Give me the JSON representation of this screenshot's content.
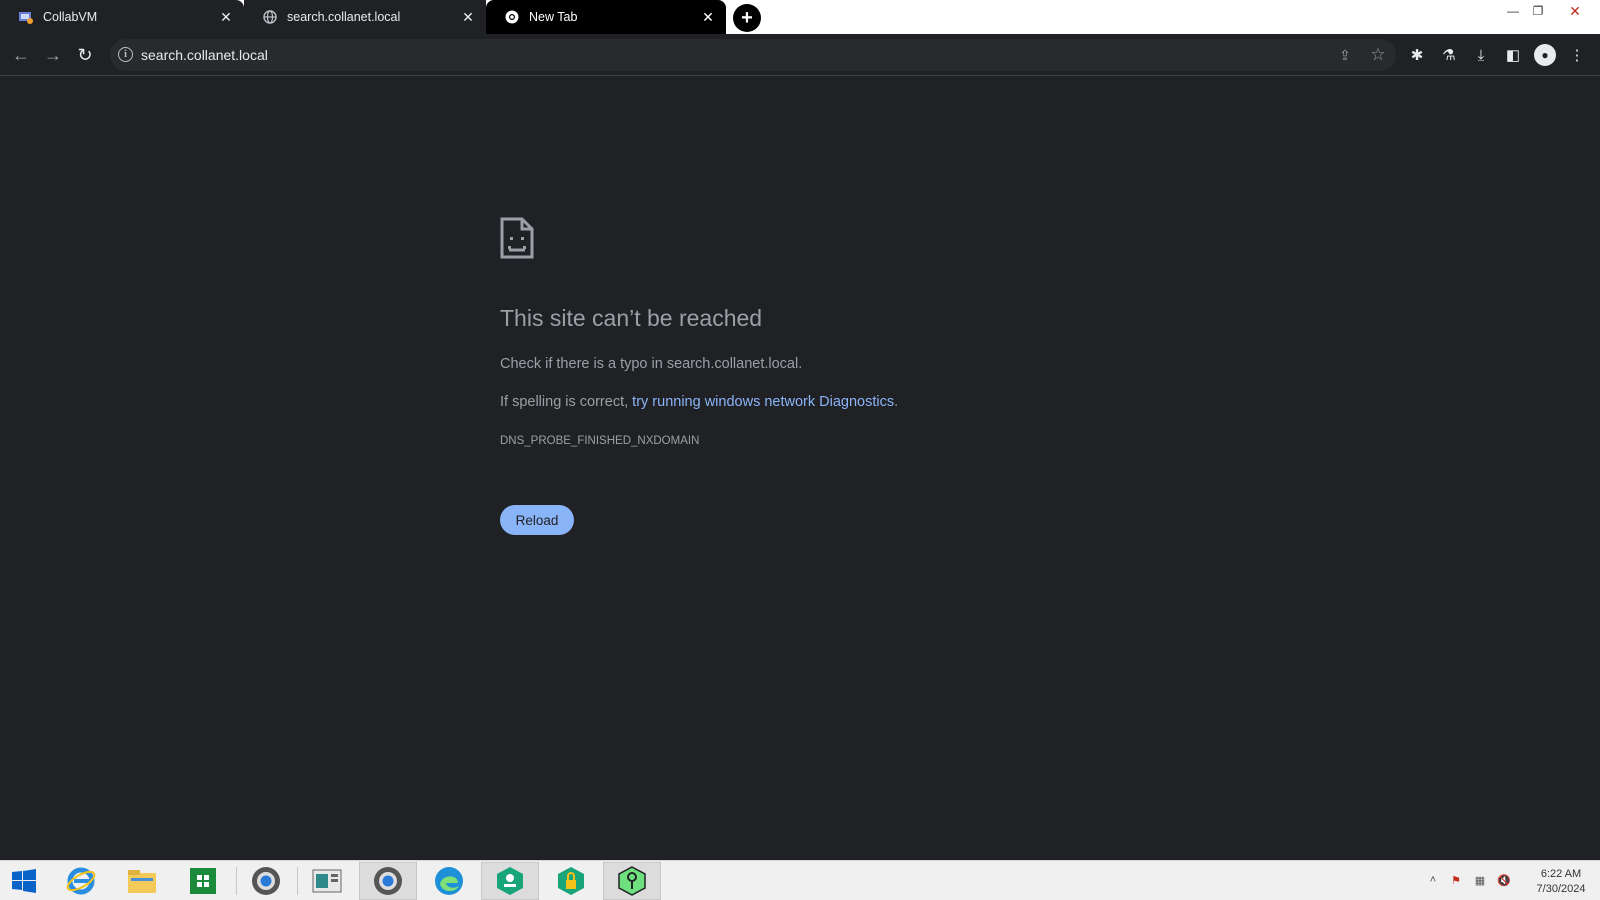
{
  "tabs": [
    {
      "title": "CollabVM",
      "favicon": "collabvm-icon"
    },
    {
      "title": "search.collanet.local",
      "favicon": "globe-icon"
    },
    {
      "title": "New Tab",
      "favicon": "chrome-icon"
    }
  ],
  "address_bar": {
    "url": "search.collanet.local"
  },
  "error": {
    "title": "This site can’t be reached",
    "line1": "Check if there is a typo in search.collanet.local.",
    "line2_prefix": "If spelling is correct, ",
    "line2_link": "try running windows network Diagnostics",
    "line2_suffix": ".",
    "code": "DNS_PROBE_FINISHED_NXDOMAIN",
    "reload_label": "Reload"
  },
  "taskbar": {
    "apps": [
      "start",
      "internet-explorer",
      "file-explorer",
      "store",
      "chrome",
      "control-panel",
      "chrome",
      "edge",
      "vpn",
      "security",
      "keys"
    ],
    "clock_time": "6:22 AM",
    "clock_date": "7/30/2024"
  },
  "colors": {
    "page_bg": "#202124",
    "link": "#8ab4f8",
    "button": "#8ab4f8",
    "text": "#9aa0a6"
  }
}
